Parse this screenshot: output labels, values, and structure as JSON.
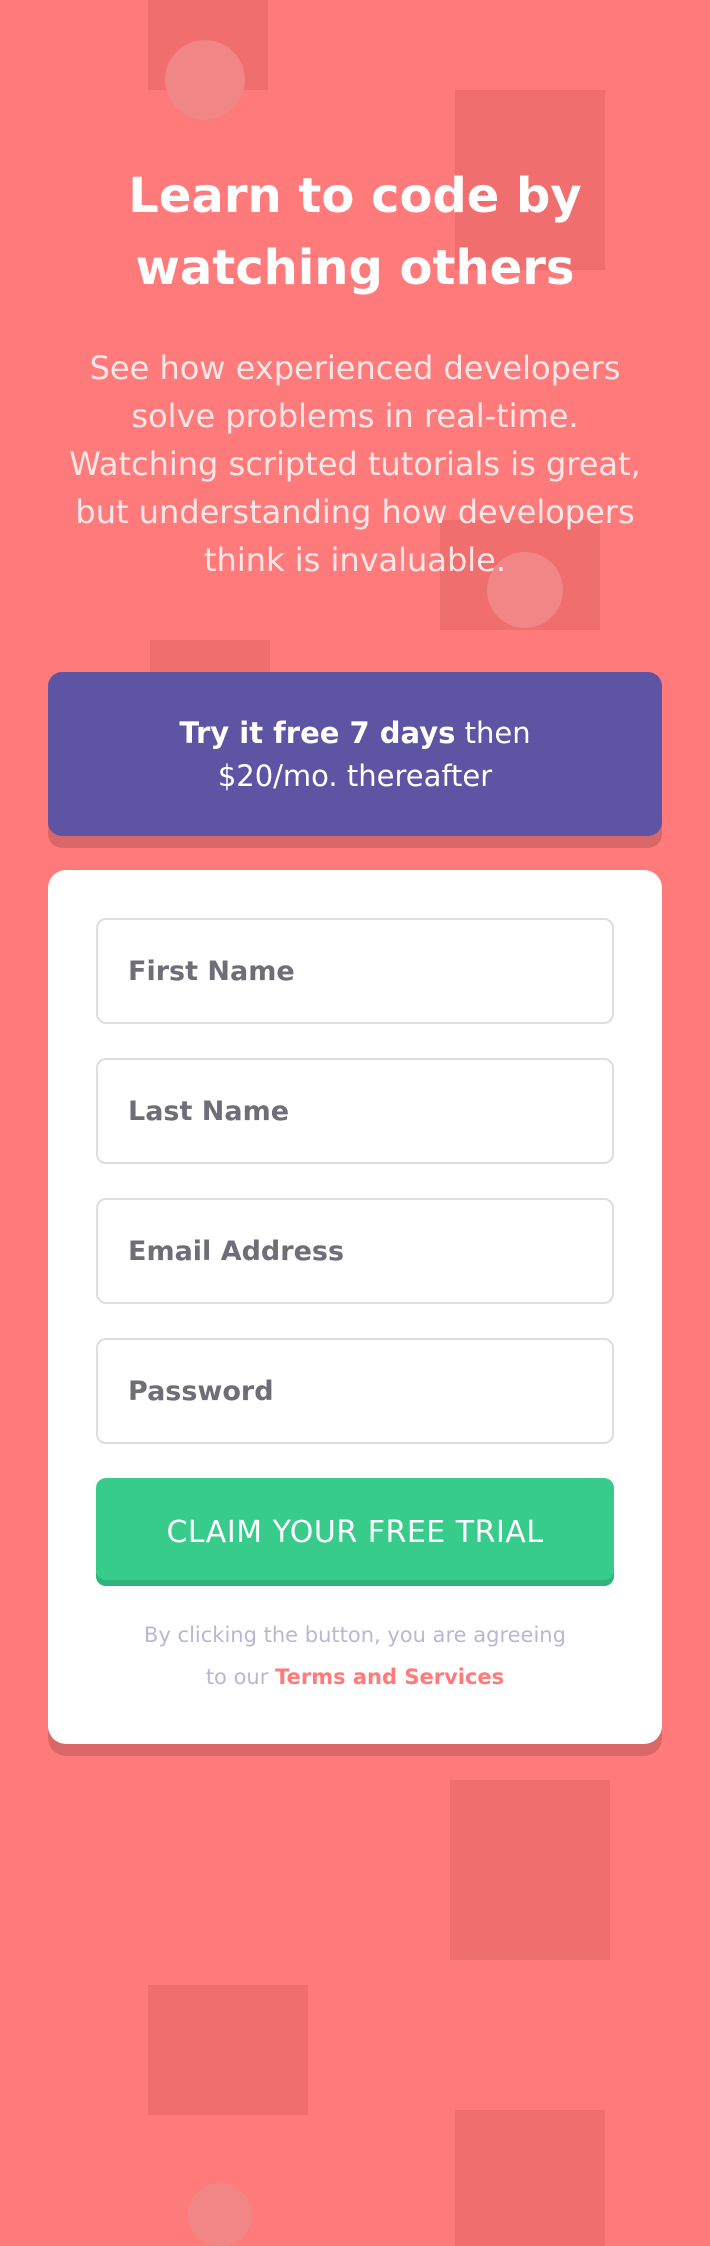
{
  "intro": {
    "title_line1": "Learn to code by",
    "title_line2": "watching others",
    "description": "See how experienced developers solve problems in real-time. Watching scripted tutorials is great, but understanding how developers think is invaluable."
  },
  "promo": {
    "bold": "Try it free 7 days",
    "text1": " then",
    "text2": "$20/mo. thereafter"
  },
  "form": {
    "first_name_placeholder": "First Name",
    "last_name_placeholder": "Last Name",
    "email_placeholder": "Email Address",
    "password_placeholder": "Password",
    "submit_label": "CLAIM YOUR FREE TRIAL",
    "terms_text1": "By clicking the button, you are agreeing",
    "terms_text2": "to our ",
    "terms_link": "Terms and Services"
  },
  "colors": {
    "background": "#ff7a7a",
    "promo": "#5e54a4",
    "cta": "#38cc8c",
    "terms_link": "#ff7a7a"
  }
}
